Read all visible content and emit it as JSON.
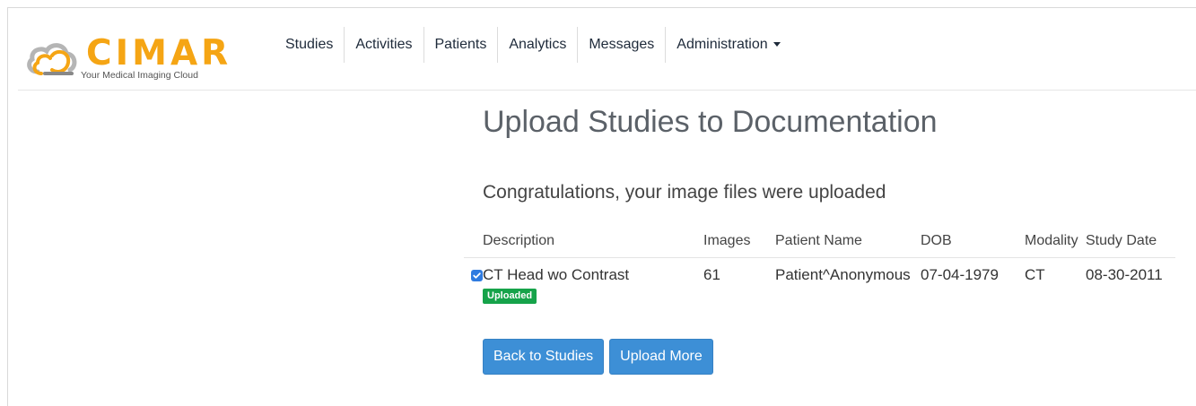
{
  "brand": {
    "name": "CIMAR",
    "tagline": "Your Medical Imaging Cloud",
    "accent_color": "#f5a514"
  },
  "nav": {
    "items": [
      {
        "label": "Studies"
      },
      {
        "label": "Activities"
      },
      {
        "label": "Patients"
      },
      {
        "label": "Analytics"
      },
      {
        "label": "Messages"
      },
      {
        "label": "Administration"
      }
    ]
  },
  "page": {
    "title": "Upload Studies to Documentation",
    "message": "Congratulations, your image files were uploaded"
  },
  "table": {
    "headers": {
      "description": "Description",
      "images": "Images",
      "patient_name": "Patient Name",
      "dob": "DOB",
      "modality": "Modality",
      "study_date": "Study Date"
    },
    "rows": [
      {
        "checked": true,
        "description": "CT Head wo Contrast",
        "status": "Uploaded",
        "images": "61",
        "patient_name": "Patient^Anonymous",
        "dob": "07-04-1979",
        "modality": "CT",
        "study_date": "08-30-2011"
      }
    ]
  },
  "actions": {
    "back_label": "Back to Studies",
    "upload_more_label": "Upload More"
  },
  "colors": {
    "button": "#3d8fd6",
    "badge": "#16a34a",
    "checkbox": "#2f7be0"
  }
}
